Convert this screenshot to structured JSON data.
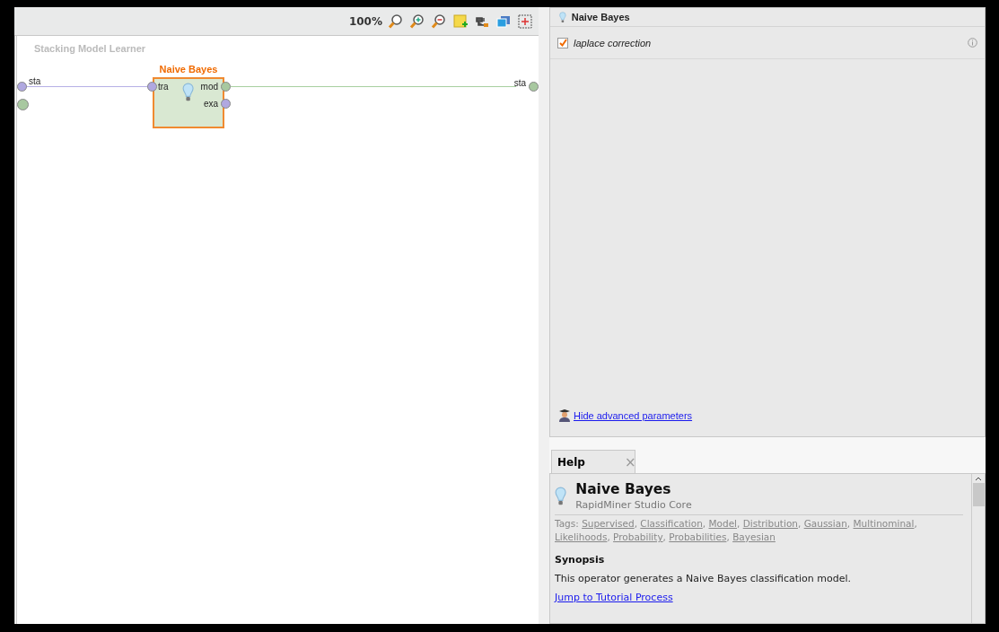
{
  "toolbar": {
    "zoom": "100%"
  },
  "process": {
    "title": "Stacking Model Learner",
    "source_ports": [
      {
        "label": "sta",
        "color": "#b0a8e0"
      }
    ],
    "sink_ports": [
      {
        "label": "sta",
        "color": "#a8c8a0"
      }
    ],
    "operator": {
      "name": "Naive Bayes",
      "selected": true,
      "inputs": [
        {
          "label": "tra",
          "color": "#b0a8e0"
        }
      ],
      "outputs": [
        {
          "label": "mod",
          "color": "#a8c8a0"
        },
        {
          "label": "exa",
          "color": "#b0a8e0"
        }
      ]
    }
  },
  "parameters": {
    "title": "Naive Bayes",
    "items": [
      {
        "label": "laplace correction",
        "checked": true
      }
    ],
    "advanced_link": "Hide advanced parameters"
  },
  "help": {
    "tab": {
      "label": "Help",
      "selected": true,
      "close": "×"
    },
    "title": "Naive Bayes",
    "subtitle": "RapidMiner Studio Core",
    "tags_label": "Tags:",
    "tag_separator": ",",
    "tags": [
      "Supervised",
      "Classification",
      "Model",
      "Distribution",
      "Gaussian",
      "Multinominal",
      "Likelihoods",
      "Probability",
      "Probabilities",
      "Bayesian"
    ],
    "synopsis_heading": "Synopsis",
    "synopsis": "This operator generates a Naive Bayes classification model.",
    "tutorial_link": "Jump to Tutorial Process"
  }
}
